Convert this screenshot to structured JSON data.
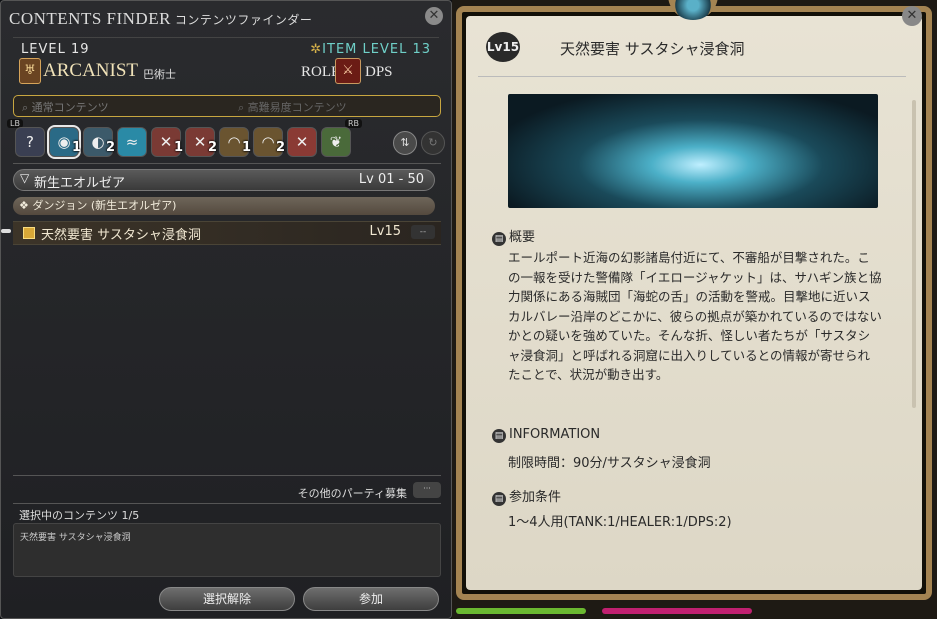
{
  "finder": {
    "title": "CONTENTS FINDER",
    "title_jp": "コンテンツファインダー",
    "level": "LEVEL 19",
    "item_level": "ITEM LEVEL 13",
    "job": "ARCANIST",
    "job_jp": "巴術士",
    "role_label": "ROLE",
    "role": "DPS",
    "search_normal": "通常コンテンツ",
    "search_high": "高難易度コンテンツ",
    "lb": "LB",
    "rb": "RB",
    "icons": [
      {
        "name": "roulette-icon",
        "glyph": "?",
        "num": ""
      },
      {
        "name": "dungeon-icon",
        "glyph": "◉",
        "num": "1"
      },
      {
        "name": "guildhest-icon",
        "glyph": "◐",
        "num": "2"
      },
      {
        "name": "trial-icon",
        "glyph": "≈",
        "num": ""
      },
      {
        "name": "raid-icon",
        "glyph": "✕",
        "num": "1"
      },
      {
        "name": "pvp-icon",
        "glyph": "✕",
        "num": "2"
      },
      {
        "name": "gold-saucer-icon",
        "glyph": "◠",
        "num": "1"
      },
      {
        "name": "special-icon",
        "glyph": "◠",
        "num": "2"
      },
      {
        "name": "frontline-icon",
        "glyph": "✕",
        "num": ""
      },
      {
        "name": "misc-icon",
        "glyph": "❦",
        "num": ""
      }
    ],
    "category": "新生エオルゼア",
    "category_levels": "Lv 01 - 50",
    "subcategory": "❖ ダンジョン (新生エオルゼア)",
    "duty": {
      "name": "天然要害 サスタシャ浸食洞",
      "level": "Lv15",
      "dash": "--"
    },
    "party_label": "その他のパーティ募集",
    "party_btn": "···",
    "selection_count": "選択中のコンテンツ 1/5",
    "selected_item": "天然要害 サスタシャ浸食洞",
    "clear_button": "選択解除",
    "join_button": "参加"
  },
  "detail": {
    "level_badge": "Lv15",
    "title": "天然要害 サスタシャ浸食洞",
    "overview_heading": "概要",
    "overview_text": "エールポート近海の幻影諸島付近にて、不審船が目撃された。この一報を受けた警備隊「イエロージャケット」は、サハギン族と協力関係にある海賊団「海蛇の舌」の活動を警戒。目撃地に近いスカルバレー沿岸のどこかに、彼らの拠点が築かれているのではないかとの疑いを強めていた。そんな折、怪しい者たちが「サスタシャ浸食洞」と呼ばれる洞窟に出入りしているとの情報が寄せられたことで、状況が動き出す。",
    "info_heading": "INFORMATION",
    "info_text": "制限時間：90分/サスタシャ浸食洞",
    "req_heading": "参加条件",
    "req_text": "1〜4人用(TANK:1/HEALER:1/DPS:2)"
  },
  "colors": {
    "accent": "#c8a640",
    "item_level": "#6fd0c8",
    "parchment": "#e4dfd0"
  }
}
